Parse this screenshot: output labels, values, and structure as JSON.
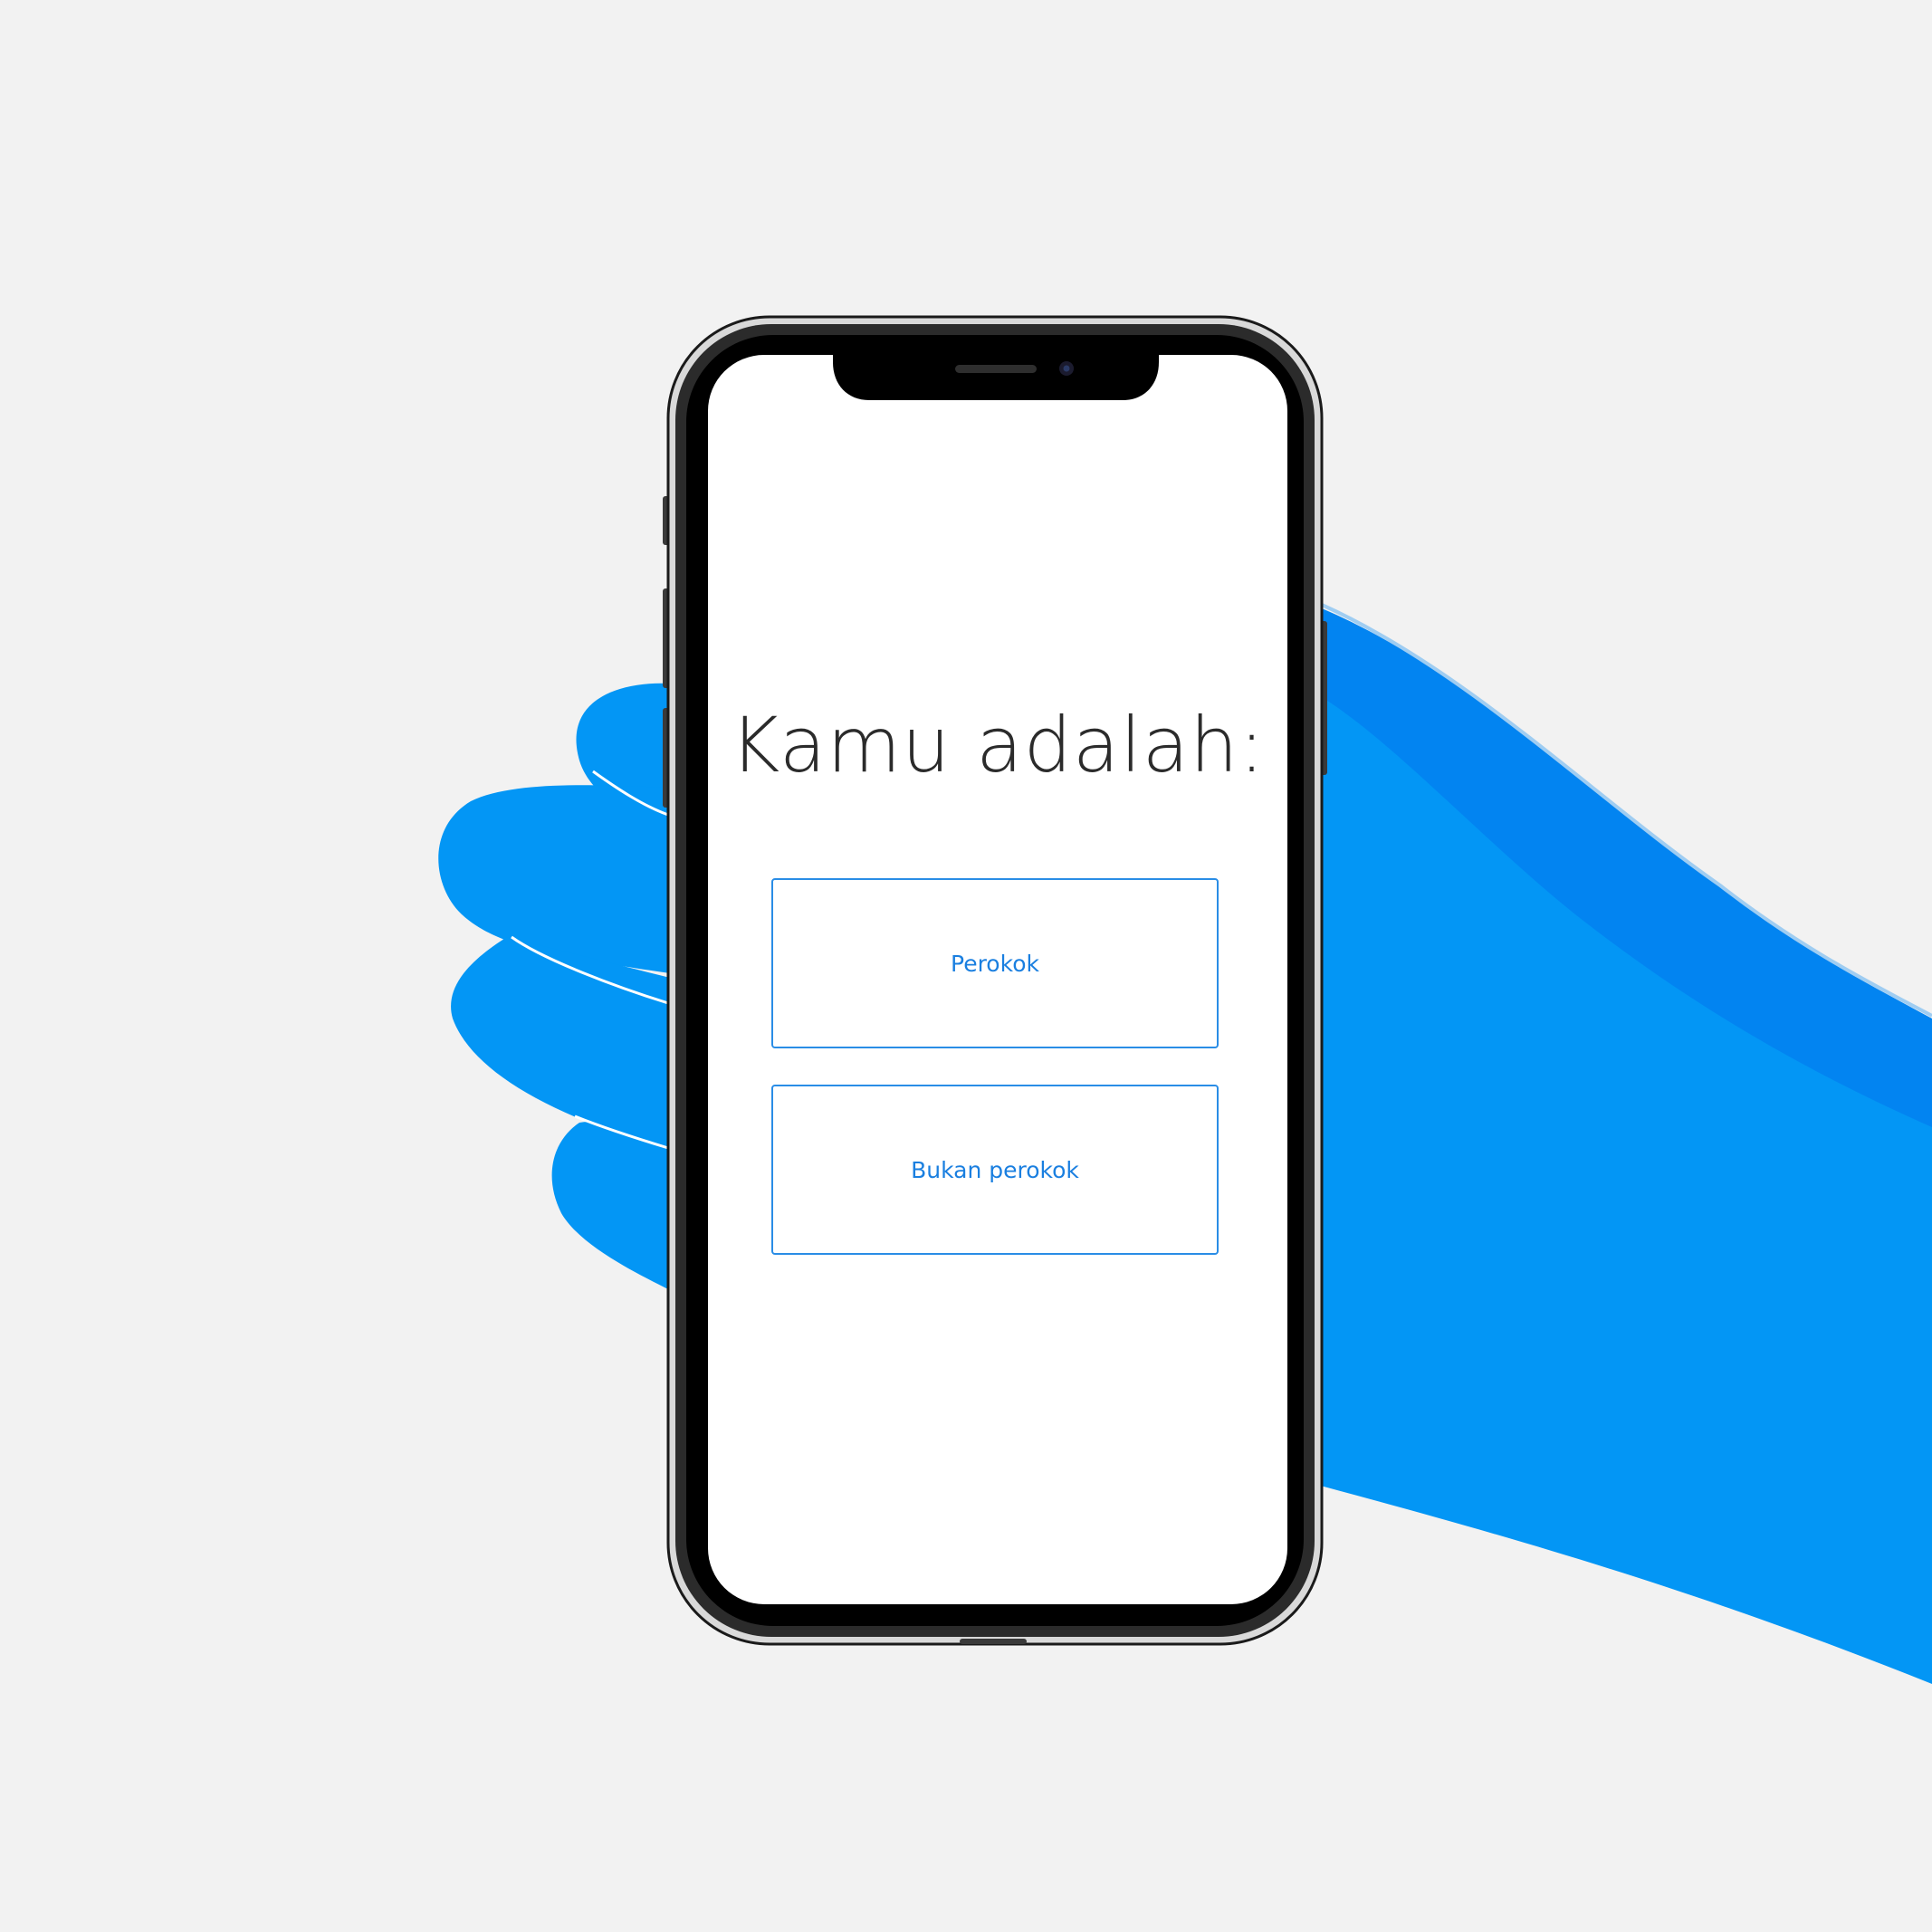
{
  "screen": {
    "title": "Kamu adalah:",
    "options": [
      {
        "label": "Perokok"
      },
      {
        "label": "Bukan perokok"
      }
    ]
  },
  "colors": {
    "background": "#f2f2f2",
    "hand": "#0396f5",
    "sleeve": "#0284f1",
    "accent": "#1a7fe0",
    "screen": "#ffffff"
  }
}
